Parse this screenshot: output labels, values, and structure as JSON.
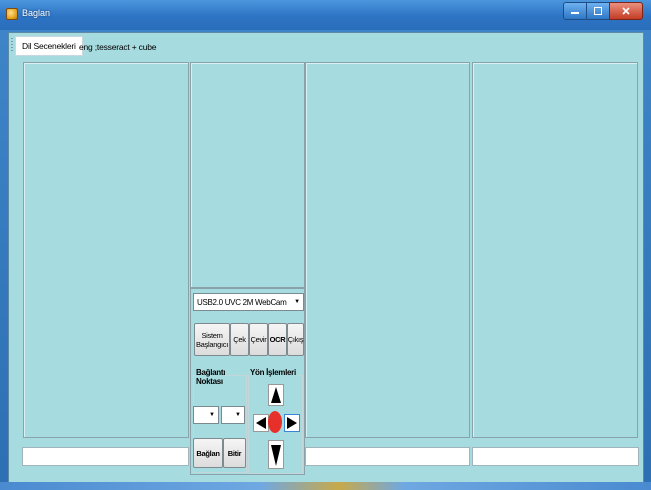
{
  "window": {
    "title": "Baglan"
  },
  "menu": {
    "language_options": "Dil Secenekleri",
    "language_value": "eng ;tesseract + cube"
  },
  "camera": {
    "selected_device": "USB2.0 UVC 2M WebCam"
  },
  "buttons": {
    "system_start": "Sistem Başlangıcı",
    "capture": "Çek",
    "rotate": "Çevir",
    "ocr": "OCR",
    "exit": "Çıkış",
    "connect": "Bağlan",
    "finish": "Bitir"
  },
  "connection": {
    "label": "Bağlantı Noktası"
  },
  "direction": {
    "label": "Yön İşlemleri"
  },
  "colors": {
    "client_bg": "#a6dbdf",
    "titlebar": "#2d74c4",
    "center_dot": "#e8302a"
  }
}
